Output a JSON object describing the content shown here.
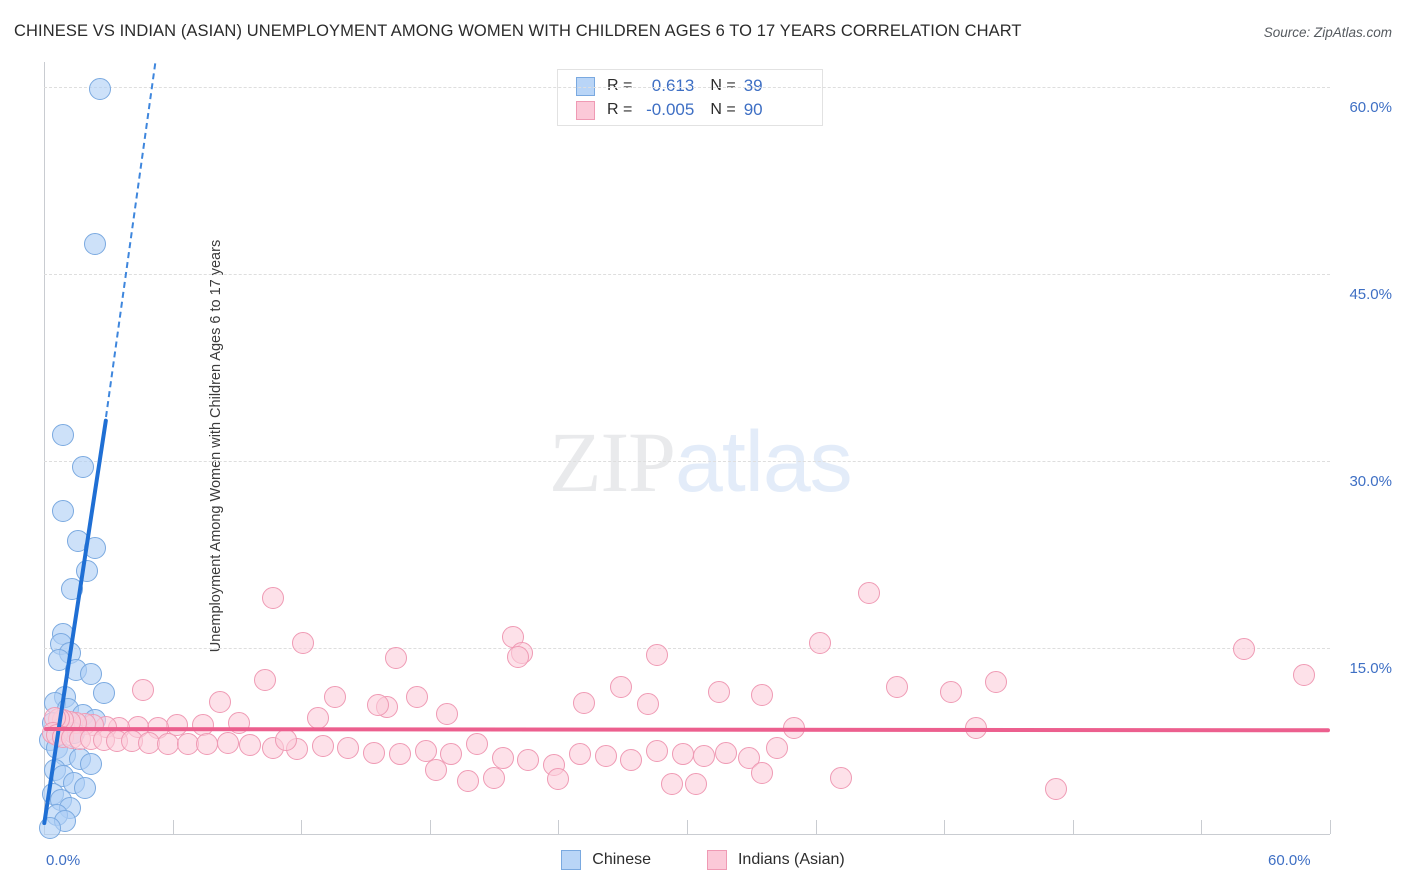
{
  "title": "CHINESE VS INDIAN (ASIAN) UNEMPLOYMENT AMONG WOMEN WITH CHILDREN AGES 6 TO 17 YEARS CORRELATION CHART",
  "source": "Source: ZipAtlas.com",
  "watermark": {
    "part1": "ZIP",
    "part2": "atlas"
  },
  "stats_legend": {
    "rows": [
      {
        "series": "Chinese",
        "r_label": "R =",
        "r_value": "0.613",
        "n_label": "N =",
        "n_value": "39",
        "color": "#b9d5f7"
      },
      {
        "series": "Indians (Asian)",
        "r_label": "R =",
        "r_value": "-0.005",
        "n_label": "N =",
        "n_value": "90",
        "color": "#fbc9d8"
      }
    ]
  },
  "bottom_legend": [
    {
      "label": "Chinese",
      "color": "#b9d5f7"
    },
    {
      "label": "Indians (Asian)",
      "color": "#fbc9d8"
    }
  ],
  "chart_data": {
    "type": "scatter",
    "title": "CHINESE VS INDIAN (ASIAN) UNEMPLOYMENT AMONG WOMEN WITH CHILDREN AGES 6 TO 17 YEARS CORRELATION CHART",
    "xlabel": "",
    "ylabel": "Unemployment Among Women with Children Ages 6 to 17 years",
    "xlim": [
      0,
      60
    ],
    "ylim": [
      0,
      62
    ],
    "grid": true,
    "x_ticks": [
      0,
      60
    ],
    "x_tick_labels": [
      "0.0%",
      "60.0%"
    ],
    "x_tick_positions_pct": [
      0,
      6,
      12,
      18,
      24,
      30,
      36,
      42,
      48,
      54,
      60
    ],
    "y_ticks": [
      15,
      30,
      45,
      60
    ],
    "y_tick_labels": [
      "15.0%",
      "30.0%",
      "45.0%",
      "60.0%"
    ],
    "legend_position": "bottom",
    "series": [
      {
        "name": "Chinese",
        "color": "#b9d5f7",
        "edge_color": "#7aa9e0",
        "r": 0.613,
        "n": 39,
        "trendline": {
          "style": "solid-with-dashed-extension",
          "color": "#1f6fd4",
          "x0": 0.0,
          "y0": 1.0,
          "x1": 2.9,
          "y1": 33.6,
          "dash_x1": 5.2,
          "dash_y1": 62.0
        },
        "points": [
          [
            2.6,
            59.8
          ],
          [
            2.4,
            47.4
          ],
          [
            0.9,
            32.1
          ],
          [
            1.8,
            29.5
          ],
          [
            0.9,
            26.0
          ],
          [
            1.6,
            23.6
          ],
          [
            2.4,
            23.0
          ],
          [
            2.0,
            21.2
          ],
          [
            1.3,
            19.7
          ],
          [
            0.9,
            16.1
          ],
          [
            0.8,
            15.3
          ],
          [
            1.2,
            14.6
          ],
          [
            0.7,
            14.0
          ],
          [
            1.5,
            13.2
          ],
          [
            2.2,
            12.9
          ],
          [
            2.8,
            11.4
          ],
          [
            1.0,
            11.1
          ],
          [
            0.5,
            10.6
          ],
          [
            1.1,
            10.1
          ],
          [
            1.8,
            9.6
          ],
          [
            2.4,
            9.2
          ],
          [
            0.4,
            9.0
          ],
          [
            0.8,
            8.5
          ],
          [
            1.4,
            8.2
          ],
          [
            0.3,
            7.6
          ],
          [
            0.6,
            7.0
          ],
          [
            1.0,
            6.4
          ],
          [
            1.7,
            6.1
          ],
          [
            2.2,
            5.7
          ],
          [
            0.5,
            5.2
          ],
          [
            0.9,
            4.7
          ],
          [
            1.4,
            4.2
          ],
          [
            1.9,
            3.8
          ],
          [
            0.4,
            3.3
          ],
          [
            0.8,
            2.8
          ],
          [
            1.2,
            2.2
          ],
          [
            0.6,
            1.6
          ],
          [
            1.0,
            1.1
          ],
          [
            0.3,
            0.6
          ]
        ]
      },
      {
        "name": "Indians (Asian)",
        "color": "#fbc9d8",
        "edge_color": "#ef9ab4",
        "r": -0.005,
        "n": 90,
        "trendline": {
          "style": "solid",
          "color": "#ec5f8e",
          "x0": 0.0,
          "y0": 8.65,
          "x1": 60.0,
          "y1": 8.55
        },
        "points": [
          [
            10.7,
            19.0
          ],
          [
            38.5,
            19.4
          ],
          [
            12.1,
            15.4
          ],
          [
            21.9,
            15.9
          ],
          [
            22.3,
            14.6
          ],
          [
            22.1,
            14.3
          ],
          [
            16.4,
            14.2
          ],
          [
            28.6,
            14.4
          ],
          [
            36.2,
            15.4
          ],
          [
            56.0,
            14.9
          ],
          [
            58.8,
            12.8
          ],
          [
            4.6,
            11.6
          ],
          [
            10.3,
            12.4
          ],
          [
            44.4,
            12.3
          ],
          [
            42.3,
            11.5
          ],
          [
            39.8,
            11.9
          ],
          [
            26.9,
            11.9
          ],
          [
            31.5,
            11.5
          ],
          [
            33.5,
            11.2
          ],
          [
            17.4,
            11.1
          ],
          [
            16.0,
            10.3
          ],
          [
            15.6,
            10.4
          ],
          [
            25.2,
            10.6
          ],
          [
            28.2,
            10.5
          ],
          [
            18.8,
            9.7
          ],
          [
            12.8,
            9.4
          ],
          [
            9.1,
            9.0
          ],
          [
            7.4,
            8.8
          ],
          [
            6.2,
            8.8
          ],
          [
            5.3,
            8.6
          ],
          [
            4.4,
            8.7
          ],
          [
            3.5,
            8.6
          ],
          [
            2.9,
            8.7
          ],
          [
            2.3,
            8.8
          ],
          [
            1.9,
            8.9
          ],
          [
            1.5,
            9.0
          ],
          [
            1.2,
            9.1
          ],
          [
            0.9,
            9.2
          ],
          [
            0.7,
            9.3
          ],
          [
            0.5,
            9.4
          ],
          [
            0.4,
            8.2
          ],
          [
            0.6,
            8.0
          ],
          [
            0.9,
            7.9
          ],
          [
            1.3,
            7.8
          ],
          [
            1.7,
            7.7
          ],
          [
            2.2,
            7.7
          ],
          [
            2.8,
            7.6
          ],
          [
            3.4,
            7.5
          ],
          [
            4.1,
            7.5
          ],
          [
            4.9,
            7.4
          ],
          [
            5.8,
            7.3
          ],
          [
            6.7,
            7.3
          ],
          [
            7.6,
            7.3
          ],
          [
            8.6,
            7.4
          ],
          [
            9.6,
            7.2
          ],
          [
            10.7,
            7.0
          ],
          [
            11.8,
            6.9
          ],
          [
            13.0,
            7.1
          ],
          [
            14.2,
            7.0
          ],
          [
            15.4,
            6.6
          ],
          [
            16.6,
            6.5
          ],
          [
            17.8,
            6.7
          ],
          [
            19.0,
            6.5
          ],
          [
            20.2,
            7.3
          ],
          [
            21.4,
            6.2
          ],
          [
            22.6,
            6.0
          ],
          [
            23.8,
            5.6
          ],
          [
            25.0,
            6.5
          ],
          [
            26.2,
            6.3
          ],
          [
            27.4,
            6.0
          ],
          [
            28.6,
            6.7
          ],
          [
            29.8,
            6.5
          ],
          [
            30.8,
            6.3
          ],
          [
            31.8,
            6.6
          ],
          [
            32.9,
            6.2
          ],
          [
            21.0,
            4.6
          ],
          [
            24.0,
            4.5
          ],
          [
            29.3,
            4.1
          ],
          [
            30.4,
            4.1
          ],
          [
            33.5,
            5.0
          ],
          [
            37.2,
            4.6
          ],
          [
            19.8,
            4.3
          ],
          [
            47.2,
            3.7
          ],
          [
            43.5,
            8.6
          ],
          [
            35.0,
            8.6
          ],
          [
            13.6,
            11.1
          ],
          [
            8.2,
            10.7
          ],
          [
            11.3,
            7.6
          ],
          [
            18.3,
            5.2
          ],
          [
            34.2,
            7.0
          ]
        ]
      }
    ]
  }
}
